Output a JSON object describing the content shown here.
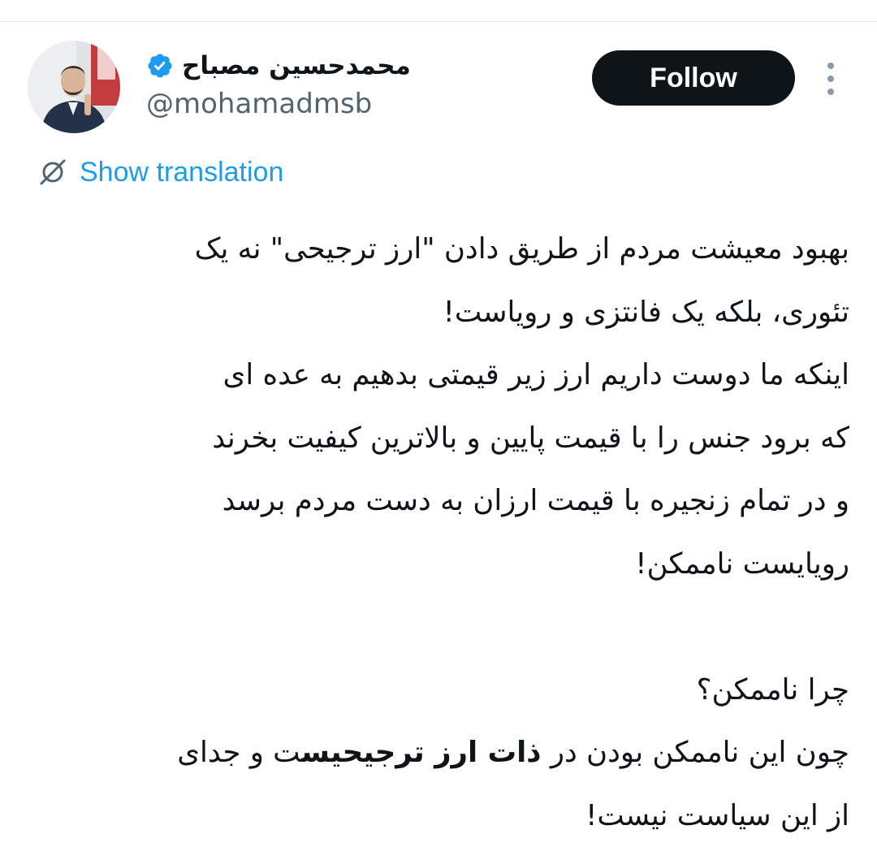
{
  "author": {
    "display_name": "محمدحسین مصباح",
    "handle": "@mohamadmsb",
    "verified": true,
    "avatar": "avatar-photo"
  },
  "follow_button": {
    "label": "Follow"
  },
  "more_button": {
    "icon": "more-vertical-icon"
  },
  "translation": {
    "icon": "translate-icon",
    "label": "Show translation"
  },
  "tweet": {
    "lines": [
      "بهبود معیشت مردم از طریق دادن \"ارز ترجیحی\" نه یک",
      "تئوری، بلکه یک فانتزی و رویاست!",
      "اینکه ما دوست داریم ارز زیر قیمتی بدهیم به عده ای",
      "که برود جنس را با قیمت پایین و بالاترین کیفیت بخرند",
      "و در تمام زنجیره با قیمت ارزان به دست مردم برسد",
      "رویایست ناممکن!",
      "",
      "چرا ناممکن؟"
    ],
    "line9": {
      "before": "چون این ناممکن بودن در ",
      "bold": "ذات ارز ترجیحیس",
      "after": "ت و جدای"
    },
    "line10": "از این سیاست نیست!"
  },
  "colors": {
    "text": "#0f1419",
    "secondary": "#536471",
    "link": "#1d9bf0",
    "button_bg": "#0f1419",
    "verified": "#1d9bf0"
  }
}
